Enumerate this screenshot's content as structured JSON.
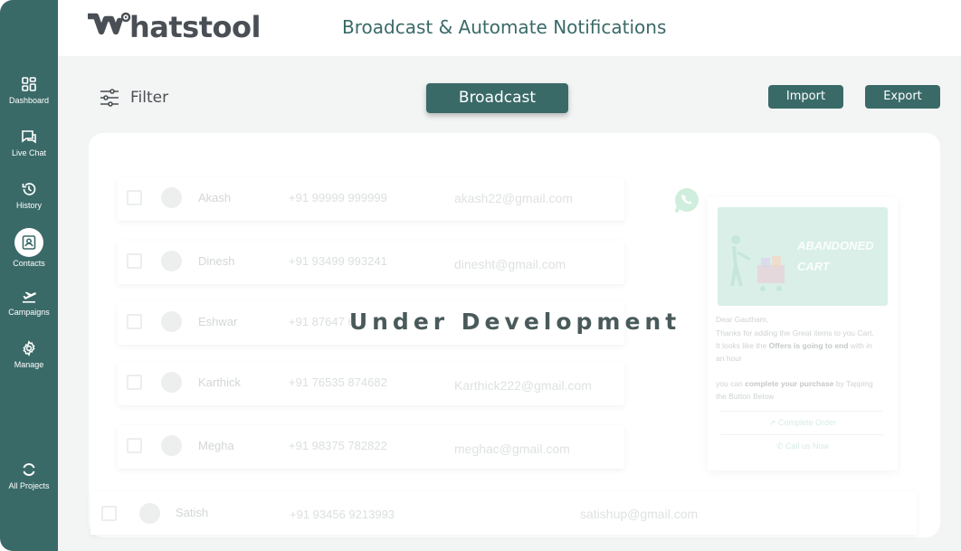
{
  "app": {
    "logo_text": "hatstool",
    "header_title": "Broadcast & Automate Notifications"
  },
  "sidebar": {
    "items": [
      {
        "label": "Dashboard",
        "icon": "dashboard-icon"
      },
      {
        "label": "Live Chat",
        "icon": "chat-icon"
      },
      {
        "label": "History",
        "icon": "history-icon"
      },
      {
        "label": "Contacts",
        "icon": "contacts-icon",
        "active": true
      },
      {
        "label": "Campaigns",
        "icon": "campaigns-icon"
      },
      {
        "label": "Manage",
        "icon": "gear-icon"
      }
    ],
    "bottom": {
      "label": "All Projects",
      "icon": "projects-icon"
    }
  },
  "toolbar": {
    "filter_label": "Filter",
    "broadcast_label": "Broadcast",
    "import_label": "Import",
    "export_label": "Export"
  },
  "contacts": [
    {
      "name": "Akash",
      "phone": "+91 99999 999999",
      "email": "akash22@gmail.com"
    },
    {
      "name": "Dinesh",
      "phone": "+91 93499 993241",
      "email": "dinesht@gmail.com"
    },
    {
      "name": "Eshwar",
      "phone": "+91 87647 6",
      "email": ""
    },
    {
      "name": "Karthick",
      "phone": "+91 76535 874682",
      "email": "Karthick222@gmail.com"
    },
    {
      "name": "Megha",
      "phone": "+91 98375 782822",
      "email": "meghac@gmail.com"
    },
    {
      "name": "Satish",
      "phone": "+91 93456 9213993",
      "email": "satishup@gmail.com"
    }
  ],
  "preview_card": {
    "banner_line1": "ABANDONED",
    "banner_line2": "CART",
    "greeting": "Dear Gautham,",
    "line1": "Thanks for adding the Great items to you Cart.",
    "line2_pre": "It looks like the ",
    "line2_bold": "Offers is going to end",
    "line2_post": " with in",
    "line3": "an hour",
    "line4_pre": "you can ",
    "line4_bold": "complete your purchase",
    "line4_post": "  by Tapping",
    "line5": "the Button Below",
    "action1": "Complete Order",
    "action2": "Call us Now"
  },
  "overlay": {
    "message": "Under Development"
  },
  "colors": {
    "primary": "#3a6a68",
    "background": "#f3f4f4",
    "logo_text": "#4a4f55"
  }
}
